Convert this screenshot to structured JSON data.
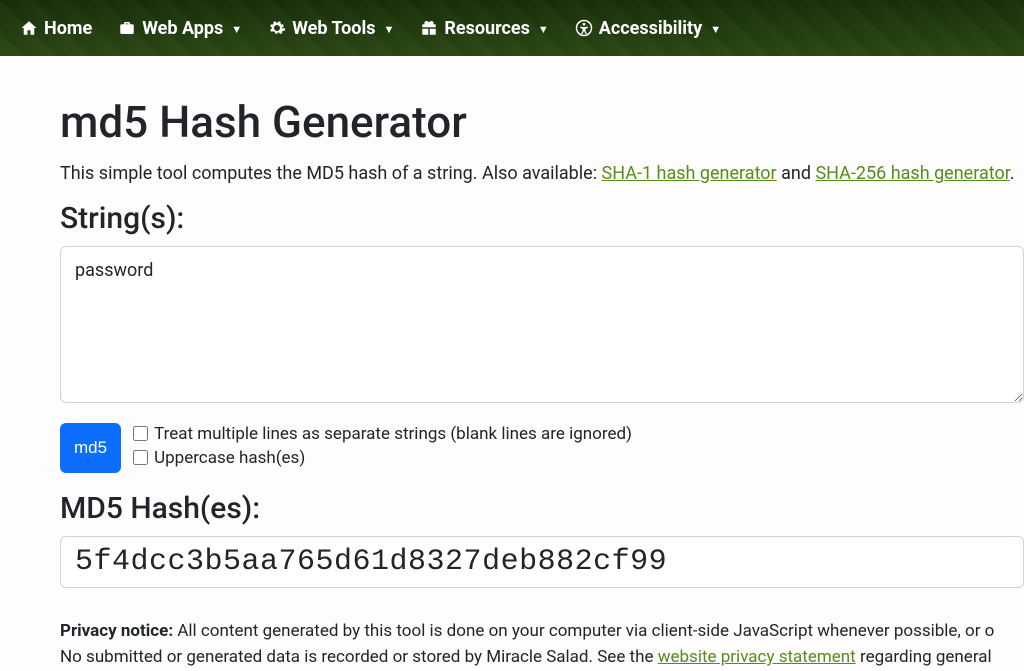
{
  "nav": {
    "home": "Home",
    "webapps": "Web Apps",
    "webtools": "Web Tools",
    "resources": "Resources",
    "accessibility": "Accessibility"
  },
  "page": {
    "title": "md5 Hash Generator",
    "intro_prefix": "This simple tool computes the MD5 hash of a string. Also available: ",
    "link_sha1": "SHA-1 hash generator",
    "intro_and": " and ",
    "link_sha256": "SHA-256 hash generator",
    "intro_suffix": "."
  },
  "form": {
    "strings_heading": "String(s):",
    "input_value": "password",
    "button_label": "md5",
    "opt_multiline": "Treat multiple lines as separate strings (blank lines are ignored)",
    "opt_uppercase": "Uppercase hash(es)"
  },
  "output": {
    "heading": "MD5 Hash(es):",
    "value": "5f4dcc3b5aa765d61d8327deb882cf99"
  },
  "privacy": {
    "label": "Privacy notice:",
    "line1": " All content generated by this tool is done on your computer via client-side JavaScript whenever possible, or o",
    "line2_prefix": "No submitted or generated data is recorded or stored by Miracle Salad. See the ",
    "link": "website privacy statement",
    "line2_suffix": " regarding general "
  }
}
